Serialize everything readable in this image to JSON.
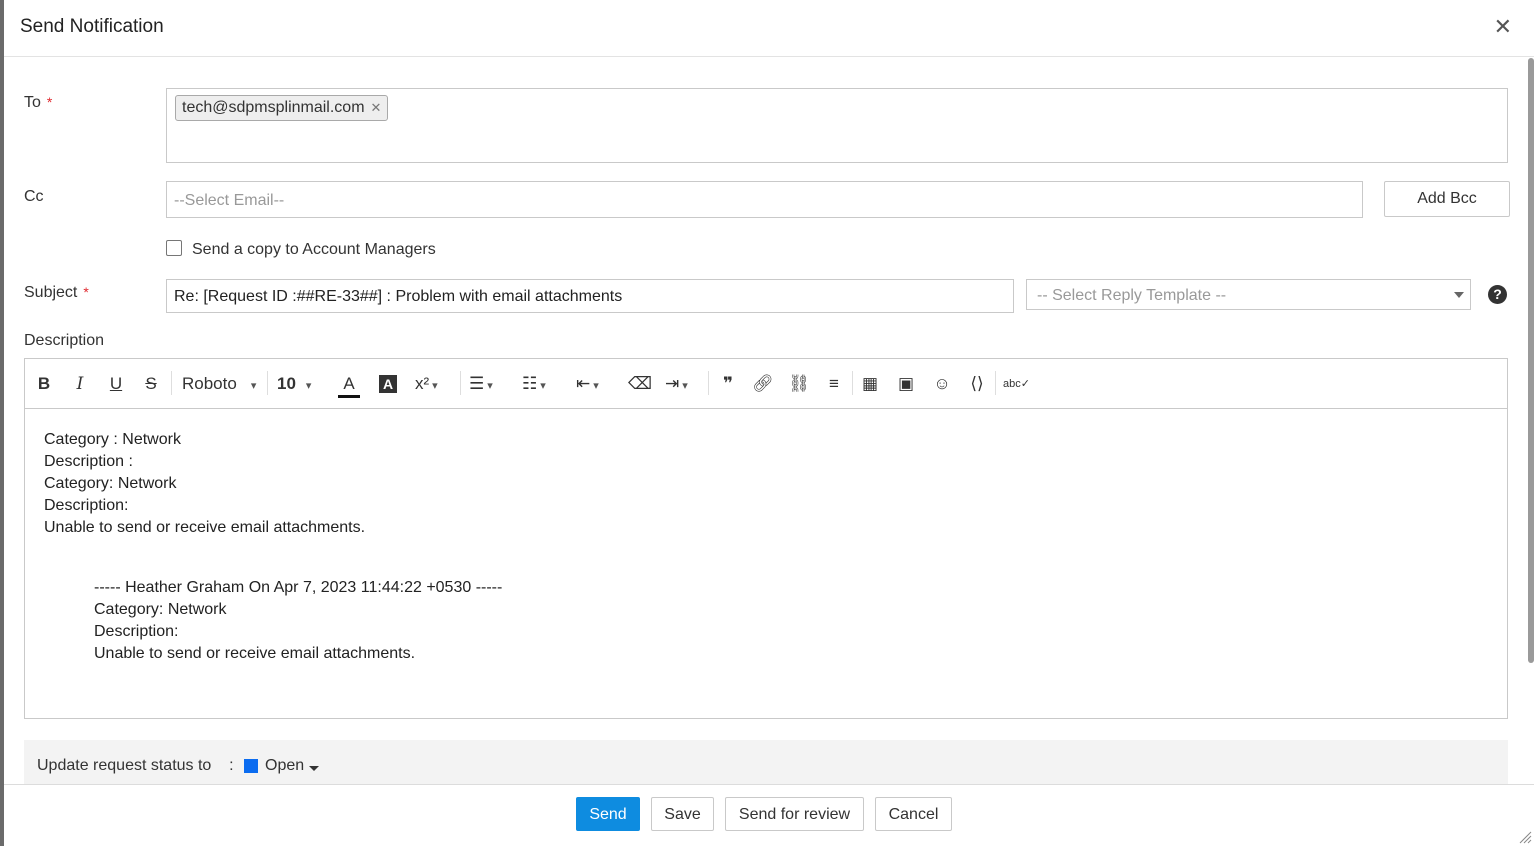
{
  "dialog": {
    "title": "Send Notification",
    "close_icon": "close-icon"
  },
  "to": {
    "label": "To",
    "required_mark": "*",
    "recipients": [
      "tech@sdpmsplinmail.com"
    ],
    "chip_remove": "✕"
  },
  "cc": {
    "label": "Cc",
    "placeholder": "--Select Email--",
    "add_bcc_label": "Add Bcc"
  },
  "copy_managers": {
    "label": "Send a copy to Account Managers",
    "checked": false
  },
  "subject": {
    "label": "Subject",
    "required_mark": "*",
    "value": "Re: [Request ID :##RE-33##] : Problem with email attachments",
    "template_placeholder": "-- Select Reply Template --"
  },
  "description": {
    "label": "Description",
    "toolbar": {
      "font_family": "Roboto",
      "font_size": "10",
      "icons": [
        "bold-icon",
        "italic-icon",
        "underline-icon",
        "strikethrough-icon",
        "font-color-icon",
        "background-color-icon",
        "superscript-icon",
        "align-icon",
        "list-icon",
        "indent-icon",
        "clear-format-icon",
        "text-direction-icon",
        "quote-icon",
        "link-icon",
        "unlink-icon",
        "line-spacing-icon",
        "table-icon",
        "image-icon",
        "emoji-icon",
        "code-icon",
        "spellcheck-icon"
      ]
    },
    "lines": [
      "Category : Network",
      "Description :",
      "Category: Network",
      "Description:",
      "Unable to send or receive email attachments."
    ],
    "quoted_lines": [
      "----- Heather Graham On Apr 7, 2023 11:44:22 +0530 -----",
      "Category: Network",
      "Description:",
      "Unable to send or receive email attachments."
    ]
  },
  "status": {
    "label": "Update request status to",
    "separator": ":",
    "value": "Open",
    "color": "#0b6cf0"
  },
  "footer": {
    "send_label": "Send",
    "save_label": "Save",
    "review_label": "Send for review",
    "cancel_label": "Cancel"
  },
  "colors": {
    "primary": "#0e8ce0",
    "required": "#e0282e"
  }
}
